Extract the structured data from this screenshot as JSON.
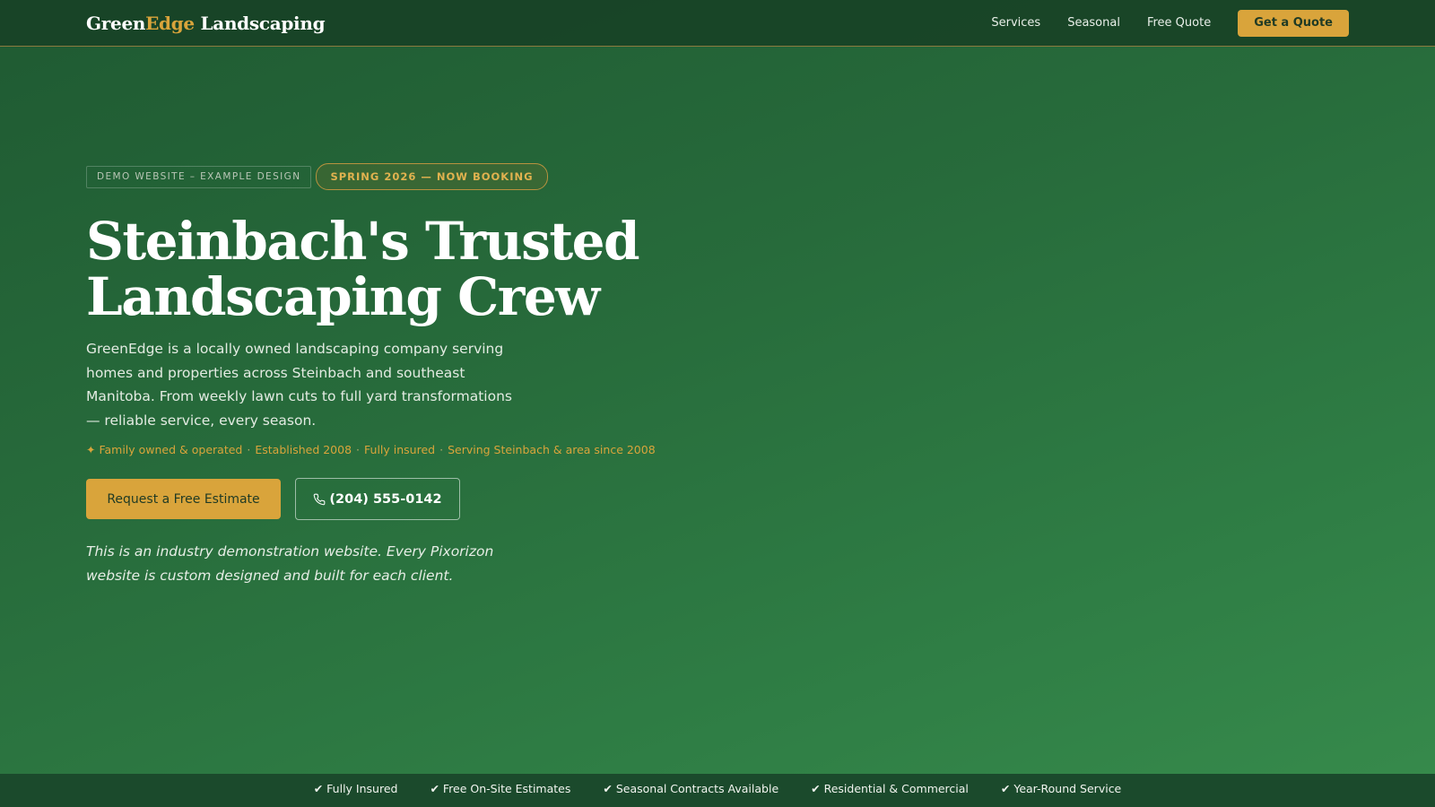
{
  "nav": {
    "logo_part1": "Green",
    "logo_part2": "Edge",
    "logo_part3": " Landscaping",
    "links": [
      "Services",
      "Seasonal",
      "Free Quote"
    ],
    "cta": "Get a Quote"
  },
  "hero": {
    "badge_demo": "Demo Website – Example Design",
    "badge_spring": "SPRING 2026 — NOW BOOKING",
    "headline_line1": "Steinbach's Trusted",
    "headline_line2": "Landscaping Crew",
    "intro": "GreenEdge is a locally owned landscaping company serving homes and properties across Steinbach and southeast Manitoba. From weekly lawn cuts to full yard transformations — reliable service, every season.",
    "facts": [
      "✦ Family owned & operated",
      "Established 2008",
      "Fully insured",
      "Serving Steinbach & area since 2008"
    ],
    "cta_primary": "Request a Free Estimate",
    "cta_phone": "(204) 555-0142",
    "disclaimer": "This is an industry demonstration website. Every Pixorizon website is custom designed and built for each client."
  },
  "strip": {
    "items": [
      "✔ Fully Insured",
      "✔ Free On-Site Estimates",
      "✔ Seasonal Contracts Available",
      "✔ Residential & Commercial",
      "✔ Year-Round Service"
    ]
  },
  "colors": {
    "accent": "#d9a43b",
    "nav_bg": "#184226",
    "strip_bg": "#1b4a2c",
    "hero_bg_start": "#1f5a32",
    "hero_bg_end": "#378b4c"
  },
  "icons": {
    "phone": "phone-icon"
  }
}
